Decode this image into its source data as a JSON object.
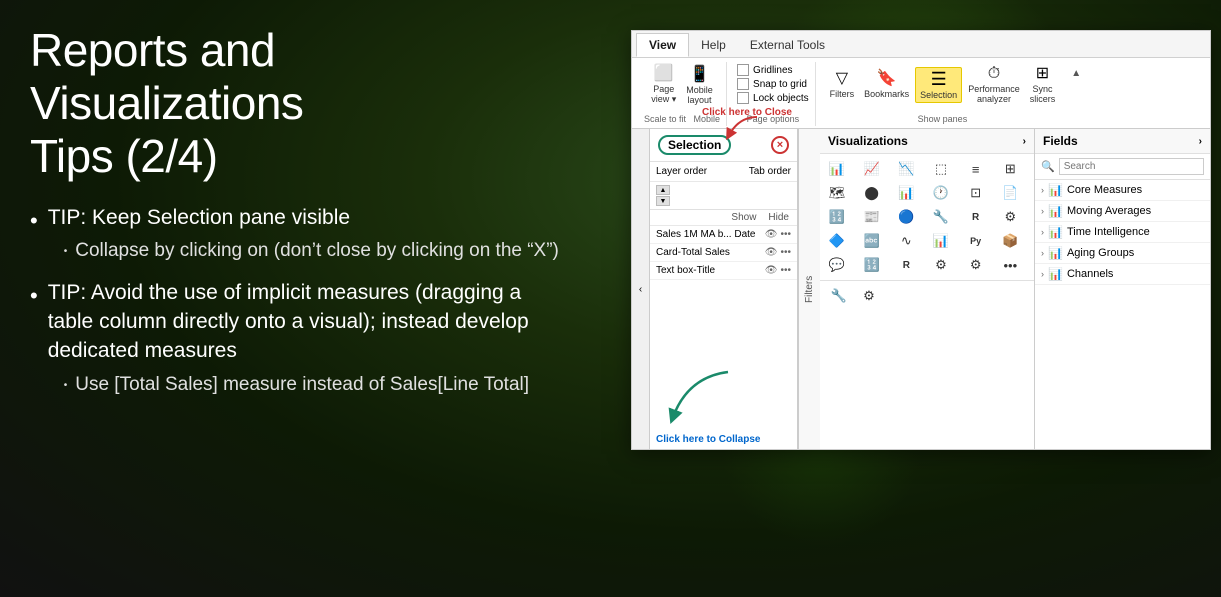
{
  "page": {
    "background": "#1a2e0a",
    "title": "Reports and Visualizations Tips (2/4)"
  },
  "left_panel": {
    "title_line1": "Reports and Visualizations",
    "title_line2": "Tips (2/4)",
    "bullets": [
      {
        "text": "TIP: Keep Selection pane visible",
        "sub_bullets": [
          "Collapse by clicking on (don’t close by clicking on the “X”)"
        ]
      },
      {
        "text": "TIP: Avoid the use of implicit measures (dragging a table column directly onto a visual); instead develop dedicated measures",
        "sub_bullets": [
          "Use [Total Sales] measure instead of Sales[Line Total]"
        ]
      }
    ]
  },
  "ribbon": {
    "tabs": [
      "View",
      "Help",
      "External Tools"
    ],
    "active_tab": "View",
    "groups": [
      {
        "name": "Scale to fit",
        "buttons": [
          {
            "label": "Page\nview",
            "icon": "📄"
          },
          {
            "label": "Mobile\nlayout",
            "icon": "📱"
          }
        ]
      },
      {
        "name": "Page options",
        "checkboxes": [
          "Gridlines",
          "Snap to grid",
          "Lock objects"
        ]
      },
      {
        "name": "Show panes",
        "buttons": [
          {
            "label": "Filters",
            "icon": "🔻",
            "active": false
          },
          {
            "label": "Bookmarks",
            "icon": "🔖",
            "active": false
          },
          {
            "label": "Selection",
            "icon": "☰",
            "active": true
          },
          {
            "label": "Performance\nanalyzer",
            "icon": "⏱",
            "active": false
          },
          {
            "label": "Sync\nslicers",
            "icon": "🔄",
            "active": false
          }
        ]
      }
    ]
  },
  "selection_pane": {
    "title": "Selection",
    "close_label": "×",
    "click_here_close": "Click here to Close",
    "click_here_collapse": "Click here to Collapse",
    "layer_order_label": "Layer order",
    "tab_order_label": "Tab order",
    "show_label": "Show",
    "hide_label": "Hide",
    "items": [
      {
        "name": "Sales 1M MA b... Date",
        "visible": true
      },
      {
        "name": "Card-Total Sales",
        "visible": true
      },
      {
        "name": "Text box-Title",
        "visible": true
      }
    ]
  },
  "visualizations_pane": {
    "title": "Visualizations",
    "icons": [
      "📊",
      "📈",
      "📉",
      "🗃",
      "📋",
      "⊞",
      "🗺",
      "🔵",
      "📊",
      "🔢",
      "🃏",
      "📄",
      "📊",
      "📰",
      "🔢",
      "🕐",
      "🔵",
      "🔧",
      "🗃",
      "📄",
      "🔷",
      "🅰",
      "∿",
      "📊",
      "Py",
      "📊",
      "💬",
      "🔢",
      "R",
      "🔧",
      "🔧",
      "🔧",
      "🔧",
      "🔧",
      "🔧",
      "•••"
    ]
  },
  "fields_pane": {
    "title": "Fields",
    "search_placeholder": "Search",
    "groups": [
      {
        "name": "Core Measures",
        "icon": "📊"
      },
      {
        "name": "Moving Averages",
        "icon": "📊"
      },
      {
        "name": "Time Intelligence",
        "icon": "📊"
      },
      {
        "name": "Aging Groups",
        "icon": "📊"
      },
      {
        "name": "Channels",
        "icon": "📊"
      }
    ]
  },
  "filters_sidebar_label": "Filters"
}
